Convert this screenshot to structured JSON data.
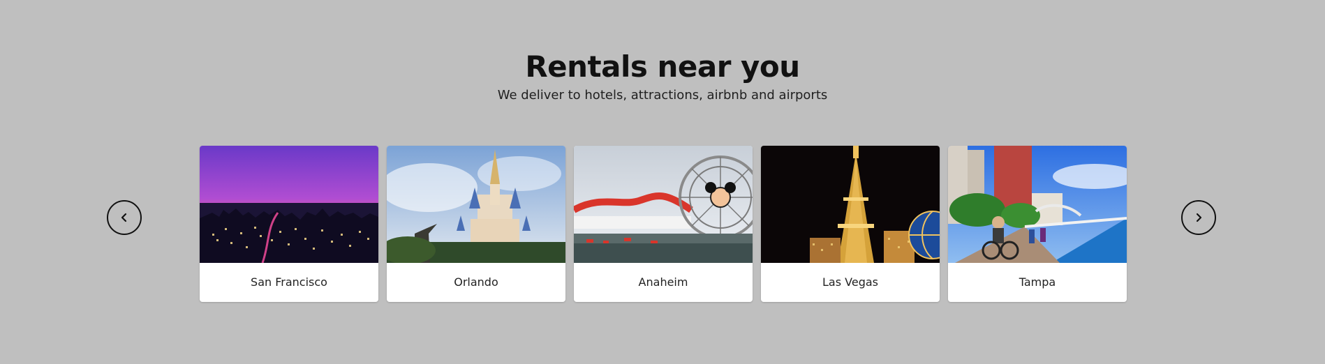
{
  "header": {
    "title": "Rentals near you",
    "subtitle": "We deliver to hotels, attractions, airbnb and airports"
  },
  "carousel": {
    "prev_icon": "chevron-left-icon",
    "next_icon": "chevron-right-icon",
    "items": [
      {
        "label": "San Francisco",
        "image": "city-skyline-at-dusk"
      },
      {
        "label": "Orlando",
        "image": "castle-with-statue"
      },
      {
        "label": "Anaheim",
        "image": "ferris-wheel-and-roller-coaster"
      },
      {
        "label": "Las Vegas",
        "image": "eiffel-tower-replica-at-night"
      },
      {
        "label": "Tampa",
        "image": "riverwalk-with-cyclist"
      }
    ]
  },
  "colors": {
    "background": "#bfbfbf",
    "card": "#ffffff",
    "text": "#111111"
  }
}
